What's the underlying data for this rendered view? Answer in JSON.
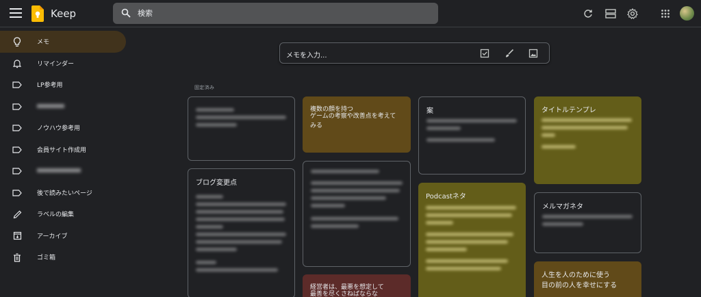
{
  "header": {
    "app_name": "Keep",
    "search_placeholder": "検索",
    "icons": [
      "menu-icon",
      "keep-logo-icon",
      "search-icon",
      "refresh-icon",
      "list-view-icon",
      "settings-icon",
      "apps-icon",
      "avatar"
    ]
  },
  "sidebar": {
    "items": [
      {
        "label": "メモ",
        "icon": "lightbulb-icon",
        "active": true
      },
      {
        "label": "リマインダー",
        "icon": "bell-icon"
      },
      {
        "label": "LP参考用",
        "icon": "label-icon"
      },
      {
        "label": "",
        "icon": "label-icon",
        "blurred": true
      },
      {
        "label": "ノウハウ参考用",
        "icon": "label-icon"
      },
      {
        "label": "会員サイト作成用",
        "icon": "label-icon"
      },
      {
        "label": "",
        "icon": "label-icon",
        "blurred": true
      },
      {
        "label": "後で読みたいページ",
        "icon": "label-icon"
      },
      {
        "label": "ラベルの編集",
        "icon": "pencil-icon"
      },
      {
        "label": "アーカイブ",
        "icon": "archive-icon"
      },
      {
        "label": "ゴミ箱",
        "icon": "trash-icon"
      }
    ]
  },
  "take_note": {
    "placeholder": "メモを入力..."
  },
  "section": {
    "pinned_label": "固定済み"
  },
  "notes": [
    {
      "title": "",
      "body": "",
      "color": "#202124"
    },
    {
      "title": "複数の顔を持つ",
      "body": "ゲームの考察や改善点を考えてみる",
      "color": "#614a19"
    },
    {
      "title": "案",
      "body": "",
      "color": "#202124"
    },
    {
      "title": "タイトルテンプレ",
      "body": "",
      "color": "#635d19"
    },
    {
      "title": "ブログ変更点",
      "body": "",
      "color": "#202124"
    },
    {
      "title": "",
      "body": "",
      "color": "#202124"
    },
    {
      "title": "Podcastネタ",
      "body": "",
      "color": "#635d19"
    },
    {
      "title": "メルマガネタ",
      "body": "",
      "color": "#202124"
    },
    {
      "title": "経営者は、最悪を想定して",
      "body": "最善を尽くさねばならな",
      "color": "#5c2b29"
    },
    {
      "title": "人生を人のために使う",
      "body": "目の前の人を幸せにする",
      "color": "#614a19"
    }
  ],
  "colors": {
    "background": "#202124",
    "accent_active": "#41331c",
    "note_yellow": "#635d19",
    "note_orange": "#614a19",
    "note_red": "#5c2b29"
  }
}
